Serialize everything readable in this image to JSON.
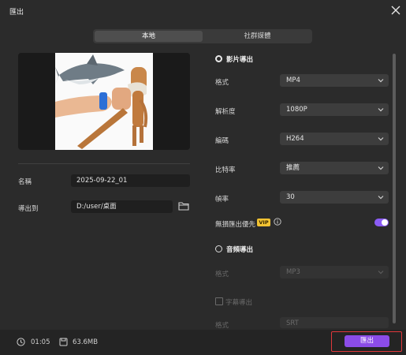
{
  "window": {
    "title": "匯出",
    "close_icon": "close-icon"
  },
  "tabs": [
    {
      "label": "本地",
      "active": true
    },
    {
      "label": "社群媒體",
      "active": false
    }
  ],
  "left": {
    "name_label": "名稱",
    "name_value": "2025-09-22_01",
    "export_to_label": "導出到",
    "export_to_value": "D:/user/桌面",
    "folder_icon": "folder-icon"
  },
  "video": {
    "section_label": "影片導出",
    "format_label": "格式",
    "format_value": "MP4",
    "resolution_label": "解析度",
    "resolution_value": "1080P",
    "codec_label": "編碼",
    "codec_value": "H264",
    "bitrate_label": "比特率",
    "bitrate_value": "推薦",
    "framerate_label": "幀率",
    "framerate_value": "30",
    "lossless_label": "無損匯出優先",
    "vip_badge": "VIP",
    "lossless_enabled": true
  },
  "audio": {
    "section_label": "音頻導出",
    "format_label": "格式",
    "format_value": "MP3"
  },
  "subtitle": {
    "checkbox_label": "字幕導出",
    "format_label": "格式",
    "format_value": "SRT"
  },
  "footer": {
    "duration": "01:05",
    "size": "63.6MB",
    "export_button": "匯出"
  },
  "colors": {
    "accent": "#8b4ce8",
    "toggle": "#8b5cf6",
    "vip": "#f1c232",
    "highlight": "#e0383b"
  }
}
